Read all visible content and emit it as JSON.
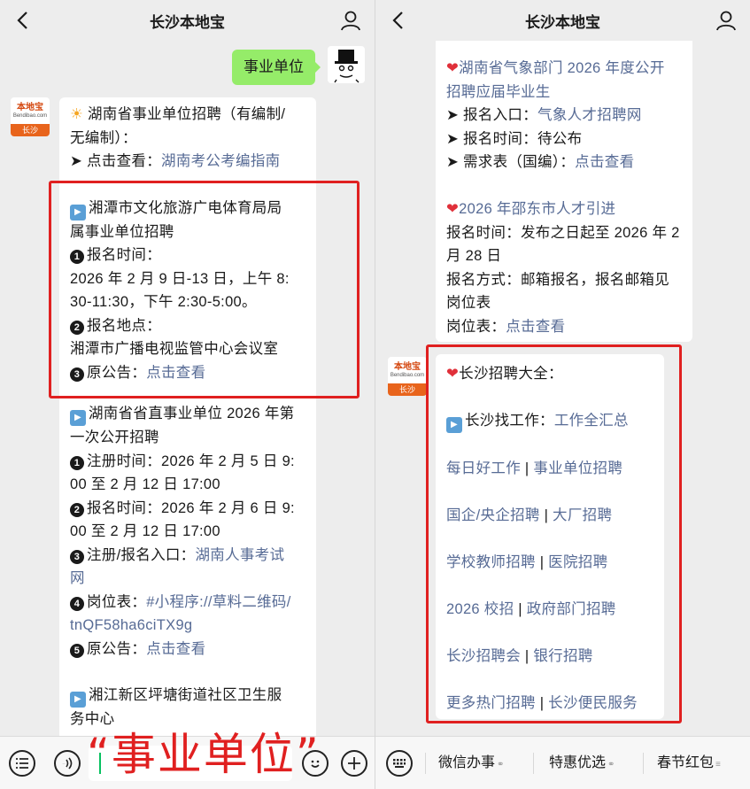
{
  "left": {
    "header": {
      "title": "长沙本地宝"
    },
    "user_message": "事业单位",
    "avatar": {
      "brand": "本地宝",
      "site": "Bendibao.com",
      "city": "长沙"
    },
    "bubble": {
      "intro": {
        "line1": "湖南省事业单位招聘（有编制/",
        "line2": "无编制）：",
        "label": "➤ 点击查看：",
        "link": "湖南考公考编指南"
      },
      "xiangtan": {
        "title1": "湘潭市文化旅游广电体育局局",
        "title2": "属事业单位招聘",
        "n1": "1",
        "item1": "报名时间：",
        "item1_v1": "2026 年 2 月 9 日-13 日，上午 8:",
        "item1_v2": "30-11:30，下午 2:30-5:00。",
        "n2": "2",
        "item2": "报名地点：",
        "item2_v": "湘潭市广播电视监管中心会议室",
        "n3": "3",
        "item3": "原公告：",
        "item3_link": "点击查看"
      },
      "hunan": {
        "title1": "湖南省省直事业单位 2026 年第",
        "title2": "一次公开招聘",
        "n1": "1",
        "reg1": "注册时间：2026 年 2 月 5 日 9:",
        "reg2": "00 至 2 月 12 日 17:00",
        "n2": "2",
        "sign1": "报名时间：2026 年 2 月 6 日 9:",
        "sign2": "00 至 2 月 12 日 17:00",
        "n3": "3",
        "entry": "注册/报名入口：",
        "entry_link1": "湖南人事考试",
        "entry_link2": "网",
        "n4": "4",
        "post": "岗位表：",
        "post_link1": "#小程序://草料二维码/",
        "post_link2": "tnQF58ha6ciTX9g",
        "n5": "5",
        "notice": "原公告：",
        "notice_link": "点击查看"
      },
      "xiangjiang": {
        "title1": "湘江新区坪塘街道社区卫生服",
        "title2": "务中心"
      }
    },
    "overlay": "“事业单位”"
  },
  "right": {
    "header": {
      "title": "长沙本地宝"
    },
    "avatar": {
      "brand": "本地宝",
      "site": "Bendibao.com",
      "city": "长沙"
    },
    "bubble1": {
      "weather_title1": "湖南省气象部门 2026 年度公开",
      "weather_title2": "招聘应届毕业生",
      "entry_label": "➤ 报名入口：",
      "entry_link": "气象人才招聘网",
      "time_label": "➤ 报名时间：待公布",
      "need_label": "➤ 需求表（国编）：",
      "need_link": "点击查看",
      "shaodong_title": "2026 年邵东市人才引进",
      "shaodong_time1": "报名时间：发布之日起至 2026 年 2",
      "shaodong_time2": "月 28 日",
      "shaodong_way1": "报名方式：邮箱报名，报名邮箱见",
      "shaodong_way2": "岗位表",
      "shaodong_post": "岗位表：",
      "shaodong_post_link": "点击查看"
    },
    "bubble2": {
      "title": "长沙招聘大全：",
      "find_label": "长沙找工作：",
      "find_link": "工作全汇总",
      "rows": [
        [
          "每日好工作",
          "事业单位招聘"
        ],
        [
          "国企/央企招聘",
          "大厂招聘"
        ],
        [
          "学校教师招聘",
          "医院招聘"
        ],
        [
          "2026 校招",
          "政府部门招聘"
        ],
        [
          "长沙招聘会",
          "银行招聘"
        ],
        [
          "更多热门招聘",
          "长沙便民服务"
        ]
      ],
      "sep": " | "
    },
    "menu": [
      "微信办事",
      "特惠优选",
      "春节红包"
    ]
  }
}
